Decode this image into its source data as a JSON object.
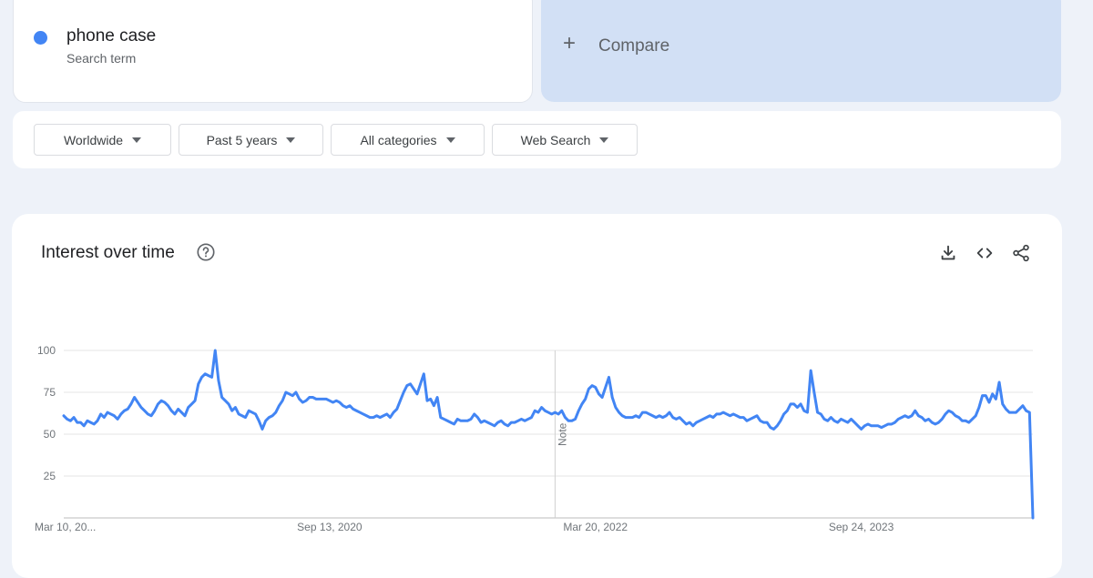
{
  "search_term": {
    "name": "phone case",
    "subtitle": "Search term",
    "color": "#4285f4"
  },
  "compare": {
    "label": "Compare"
  },
  "filters": [
    {
      "label": "Worldwide"
    },
    {
      "label": "Past 5 years"
    },
    {
      "label": "All categories"
    },
    {
      "label": "Web Search"
    }
  ],
  "chart": {
    "title": "Interest over time",
    "icons": [
      "help-icon",
      "download-icon",
      "embed-icon",
      "share-icon"
    ]
  },
  "chart_data": {
    "type": "line",
    "title": "Interest over time",
    "xlabel": "",
    "ylabel": "",
    "ylim": [
      0,
      100
    ],
    "yticks": [
      100,
      75,
      50,
      25
    ],
    "x_tick_labels": [
      "Mar 10, 20...",
      "Sep 13, 2020",
      "Mar 20, 2022",
      "Sep 24, 2023"
    ],
    "x_tick_index": [
      0,
      79,
      158,
      237
    ],
    "note": {
      "label": "Note",
      "index": 146
    },
    "grid": true,
    "line_color": "#4285f4",
    "series": [
      {
        "values": [
          61,
          59,
          58,
          60,
          57,
          57,
          55,
          58,
          57,
          56,
          58,
          62,
          60,
          63,
          62,
          61,
          59,
          62,
          64,
          65,
          68,
          72,
          69,
          66,
          64,
          62,
          61,
          64,
          68,
          70,
          69,
          67,
          64,
          62,
          65,
          63,
          61,
          66,
          68,
          70,
          80,
          84,
          86,
          85,
          84,
          100,
          82,
          72,
          70,
          68,
          64,
          66,
          62,
          61,
          60,
          64,
          63,
          62,
          58,
          53,
          58,
          60,
          61,
          63,
          67,
          70,
          75,
          74,
          73,
          75,
          71,
          69,
          70,
          72,
          72,
          71,
          71,
          71,
          71,
          70,
          69,
          70,
          69,
          67,
          66,
          67,
          65,
          64,
          63,
          62,
          61,
          60,
          60,
          61,
          60,
          61,
          62,
          60,
          63,
          65,
          70,
          75,
          79,
          80,
          77,
          74,
          80,
          86,
          70,
          71,
          67,
          72,
          60,
          59,
          58,
          57,
          56,
          59,
          58,
          58,
          58,
          59,
          62,
          60,
          57,
          58,
          57,
          56,
          55,
          57,
          58,
          56,
          55,
          57,
          57,
          58,
          59,
          58,
          59,
          60,
          64,
          63,
          66,
          64,
          63,
          62,
          63,
          62,
          64,
          60,
          58,
          58,
          59,
          64,
          68,
          71,
          77,
          79,
          78,
          74,
          72,
          78,
          84,
          72,
          66,
          63,
          61,
          60,
          60,
          60,
          61,
          60,
          63,
          63,
          62,
          61,
          60,
          61,
          60,
          61,
          63,
          60,
          59,
          60,
          58,
          56,
          57,
          55,
          57,
          58,
          59,
          60,
          61,
          60,
          62,
          62,
          63,
          62,
          61,
          62,
          61,
          60,
          60,
          58,
          59,
          60,
          61,
          58,
          57,
          57,
          54,
          53,
          55,
          58,
          62,
          64,
          68,
          68,
          66,
          68,
          64,
          63,
          88,
          75,
          63,
          62,
          59,
          58,
          60,
          58,
          57,
          59,
          58,
          57,
          59,
          57,
          55,
          53,
          55,
          56,
          55,
          55,
          55,
          54,
          55,
          56,
          56,
          57,
          59,
          60,
          61,
          60,
          61,
          64,
          61,
          60,
          58,
          59,
          57,
          56,
          57,
          59,
          62,
          64,
          63,
          61,
          60,
          58,
          58,
          57,
          59,
          61,
          66,
          73,
          73,
          69,
          74,
          71,
          81,
          68,
          65,
          63,
          63,
          63,
          65,
          67,
          64,
          63,
          0
        ]
      }
    ]
  }
}
